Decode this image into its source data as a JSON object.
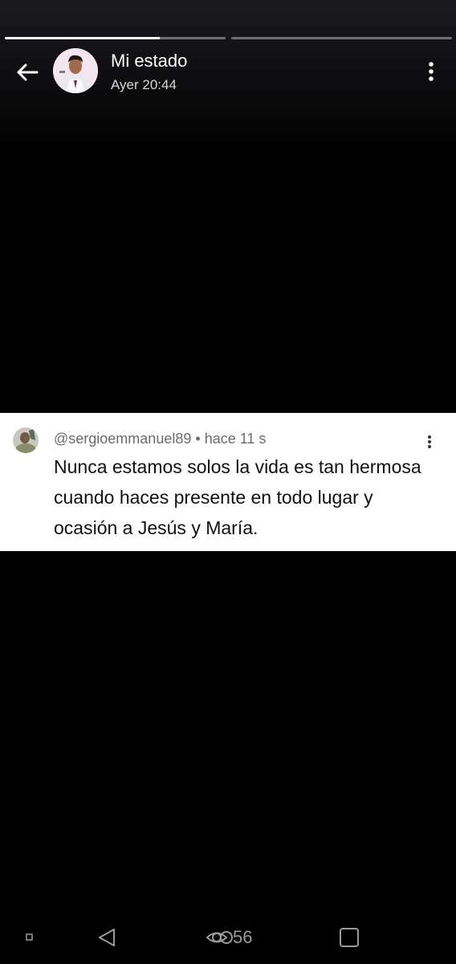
{
  "story": {
    "title": "Mi estado",
    "timestamp": "Ayer 20:44",
    "progress": [
      0.7,
      0
    ]
  },
  "comment": {
    "username": "@sergioemmanuel89",
    "separator": "•",
    "time": "hace 11 s",
    "text": "Nunca estamos solos la vida es tan hermosa cuando haces presente en todo lugar y ocasión a Jesús y María."
  },
  "views": {
    "count": "56"
  },
  "icons": {
    "back": "arrow-left-icon",
    "more": "more-vertical-icon",
    "views": "eye-icon",
    "nav_back": "triangle-back-icon",
    "nav_home": "square-home-icon",
    "nav_menu": "small-square-icon"
  },
  "colors": {
    "background": "#000000",
    "progress_track": "#6f6f74",
    "progress_fill": "#ffffff",
    "card": "#ffffff"
  }
}
